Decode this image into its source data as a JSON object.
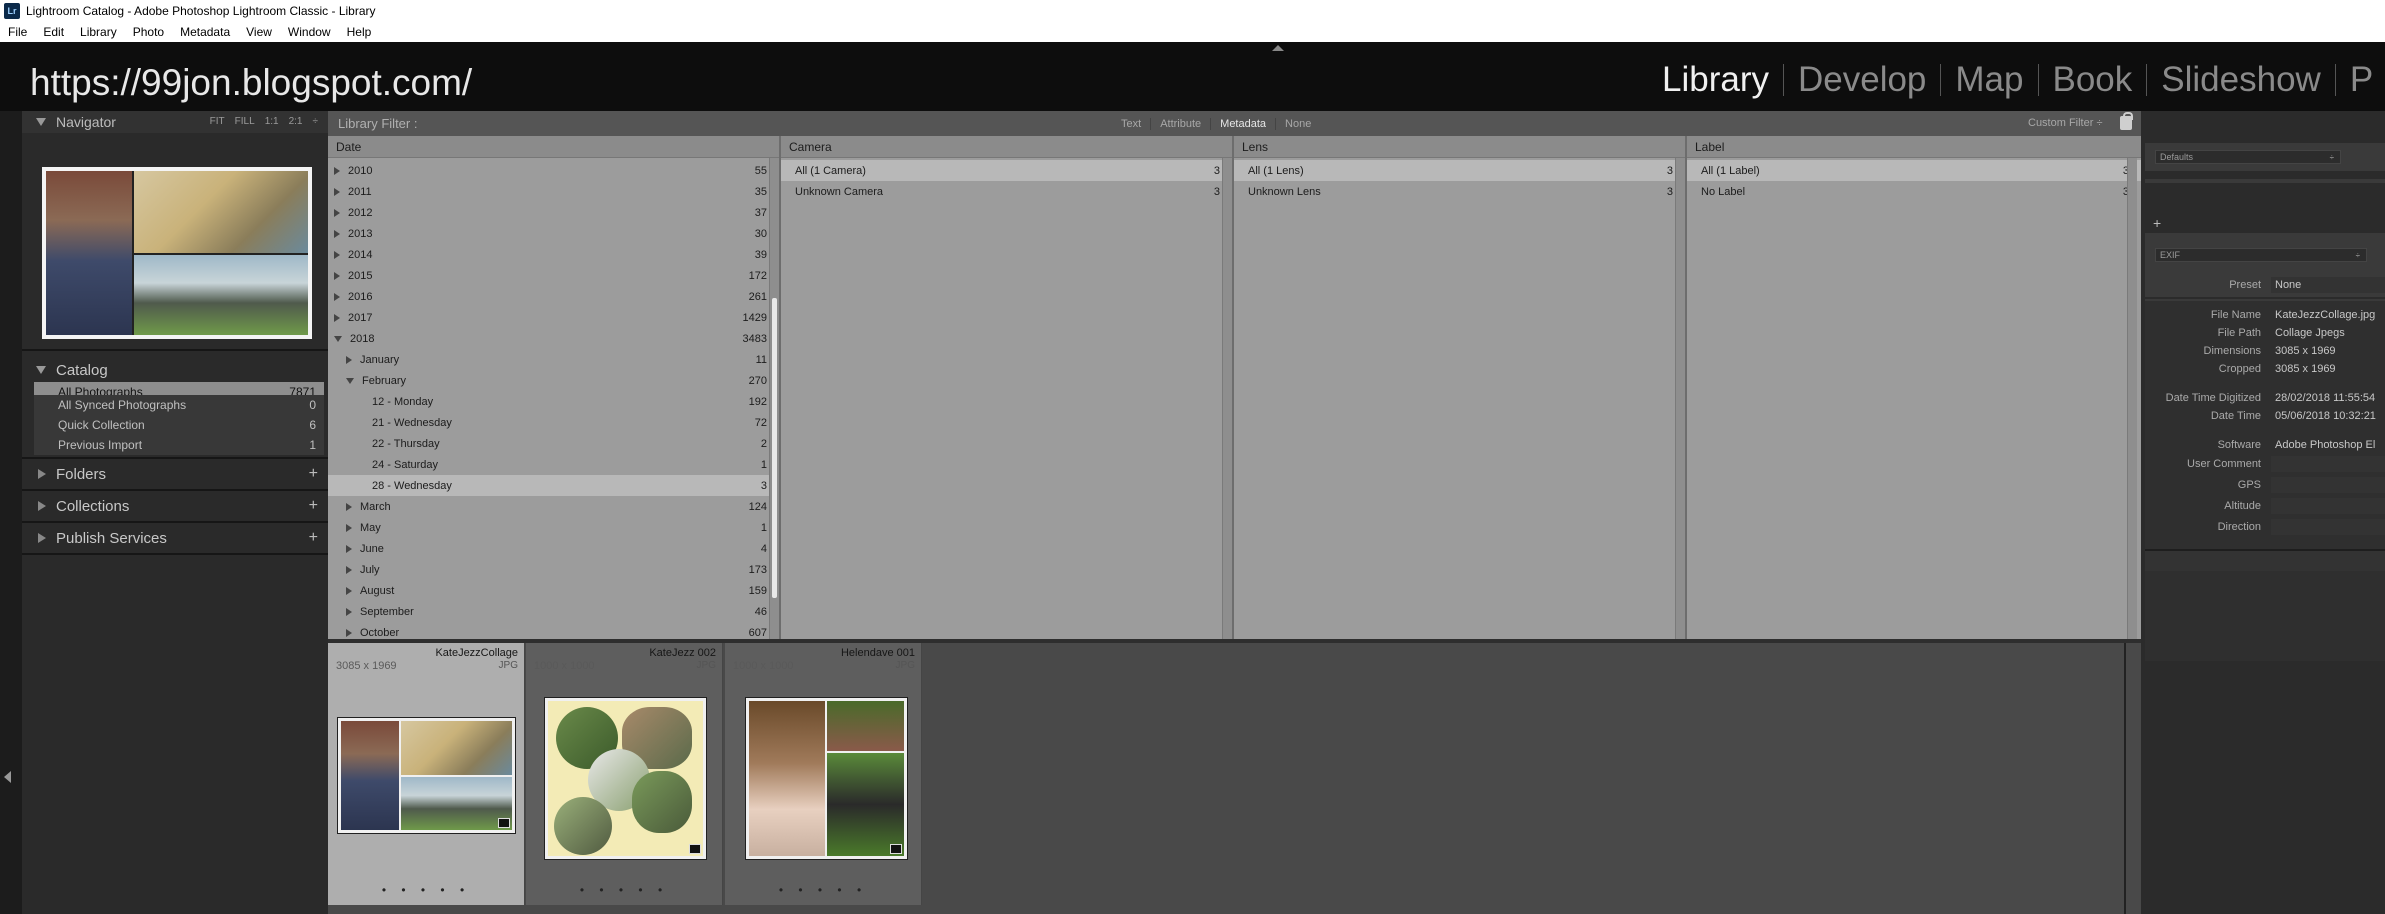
{
  "window": {
    "title": "Lightroom Catalog - Adobe Photoshop Lightroom Classic - Library",
    "app_icon": "Lr"
  },
  "menu": [
    "File",
    "Edit",
    "Library",
    "Photo",
    "Metadata",
    "View",
    "Window",
    "Help"
  ],
  "identity_plate": "https://99jon.blogspot.com/",
  "modules": [
    "Library",
    "Develop",
    "Map",
    "Book",
    "Slideshow",
    "P"
  ],
  "active_module": "Library",
  "navigator": {
    "title": "Navigator",
    "zoom": [
      "FIT",
      "FILL",
      "1:1",
      "2:1"
    ]
  },
  "catalog": {
    "title": "Catalog",
    "items": [
      {
        "label": "All Photographs",
        "count": "7871"
      },
      {
        "label": "All Synced Photographs",
        "count": "0"
      },
      {
        "label": "Quick Collection",
        "count": "6"
      },
      {
        "label": "Previous Import",
        "count": "1"
      }
    ]
  },
  "panels": {
    "folders": "Folders",
    "collections": "Collections",
    "publish": "Publish Services"
  },
  "filter_bar": {
    "title": "Library Filter :",
    "tabs": [
      "Text",
      "Attribute",
      "Metadata",
      "None"
    ],
    "active_tab": "Metadata",
    "custom_filter": "Custom Filter ÷"
  },
  "columns": {
    "date": {
      "header": "Date",
      "rows": [
        {
          "label": "2010",
          "count": "55"
        },
        {
          "label": "2011",
          "count": "35"
        },
        {
          "label": "2012",
          "count": "37"
        },
        {
          "label": "2013",
          "count": "30"
        },
        {
          "label": "2014",
          "count": "39"
        },
        {
          "label": "2015",
          "count": "172"
        },
        {
          "label": "2016",
          "count": "261"
        },
        {
          "label": "2017",
          "count": "1429"
        },
        {
          "label": "2018",
          "count": "3483"
        },
        {
          "label": "January",
          "count": "11"
        },
        {
          "label": "February",
          "count": "270"
        },
        {
          "label": "12 - Monday",
          "count": "192"
        },
        {
          "label": "21 - Wednesday",
          "count": "72"
        },
        {
          "label": "22 - Thursday",
          "count": "2"
        },
        {
          "label": "24 - Saturday",
          "count": "1"
        },
        {
          "label": "28 - Wednesday",
          "count": "3"
        },
        {
          "label": "March",
          "count": "124"
        },
        {
          "label": "May",
          "count": "1"
        },
        {
          "label": "June",
          "count": "4"
        },
        {
          "label": "July",
          "count": "173"
        },
        {
          "label": "August",
          "count": "159"
        },
        {
          "label": "September",
          "count": "46"
        },
        {
          "label": "October",
          "count": "607"
        }
      ]
    },
    "camera": {
      "header": "Camera",
      "rows": [
        {
          "label": "All (1 Camera)",
          "count": "3"
        },
        {
          "label": "Unknown Camera",
          "count": "3"
        }
      ]
    },
    "lens": {
      "header": "Lens",
      "rows": [
        {
          "label": "All (1 Lens)",
          "count": "3"
        },
        {
          "label": "Unknown Lens",
          "count": "3"
        }
      ]
    },
    "label": {
      "header": "Label",
      "rows": [
        {
          "label": "All (1 Label)",
          "count": "3"
        },
        {
          "label": "No Label",
          "count": "3"
        }
      ]
    }
  },
  "grid": [
    {
      "name": "KateJezzCollage",
      "dims": "3085 x 1969",
      "ext": "JPG",
      "dots": "• • • • •"
    },
    {
      "name": "KateJezz 002",
      "dims": "1000 x 1000",
      "ext": "JPG",
      "dots": "• • • • •"
    },
    {
      "name": "Helendave 001",
      "dims": "1000 x 1000",
      "ext": "JPG",
      "dots": "• • • • •"
    }
  ],
  "right_panel": {
    "defaults": "Defaults",
    "plus": "+",
    "exif": "EXIF",
    "preset_label": "Preset",
    "preset_value": "None",
    "fields": [
      {
        "key": "File Name",
        "value": "KateJezzCollage.jpg"
      },
      {
        "key": "File Path",
        "value": "Collage Jpegs"
      },
      {
        "key": "Dimensions",
        "value": "3085 x 1969"
      },
      {
        "key": "Cropped",
        "value": "3085 x 1969"
      },
      {
        "key": "Date Time Digitized",
        "value": "28/02/2018 11:55:54"
      },
      {
        "key": "Date Time",
        "value": "05/06/2018 10:32:21"
      },
      {
        "key": "Software",
        "value": "Adobe Photoshop El"
      },
      {
        "key": "User Comment",
        "value": ""
      },
      {
        "key": "GPS",
        "value": ""
      },
      {
        "key": "Altitude",
        "value": ""
      },
      {
        "key": "Direction",
        "value": ""
      }
    ]
  }
}
